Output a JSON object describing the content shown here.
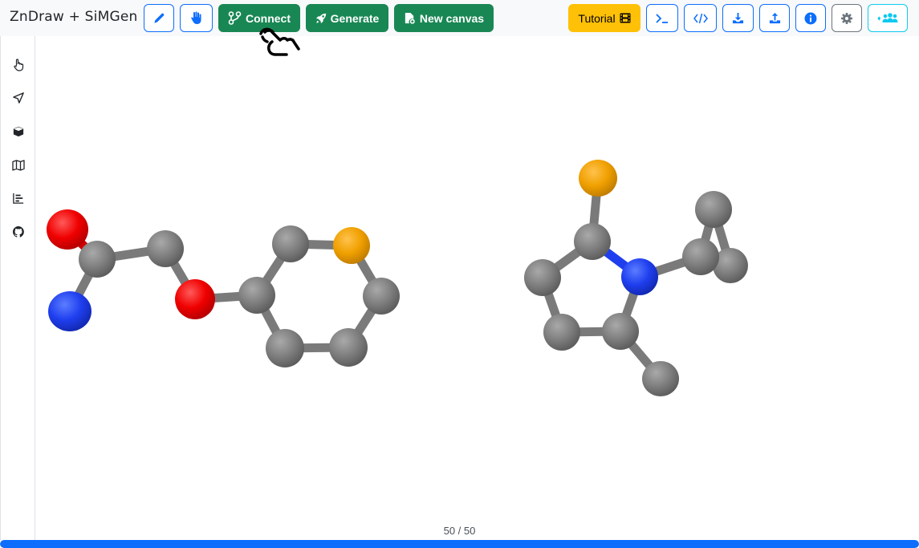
{
  "app": {
    "title": "ZnDraw + SiMGen"
  },
  "toolbar": {
    "left_buttons": [
      {
        "name": "draw-button",
        "icon": "pencil-icon"
      },
      {
        "name": "interaction-button",
        "icon": "hand-icon"
      }
    ],
    "connect_label": "Connect",
    "generate_label": "Generate",
    "new_canvas_label": "New canvas",
    "tutorial_label": "Tutorial",
    "right_icons": [
      "terminal-icon",
      "code-icon",
      "download-icon",
      "upload-icon",
      "info-icon",
      "gear-icon",
      "users-icon"
    ]
  },
  "sidebar": {
    "items": [
      {
        "name": "sidebar-item-selection",
        "icon": "pointer-hand-icon"
      },
      {
        "name": "sidebar-item-geometry",
        "icon": "send-icon"
      },
      {
        "name": "sidebar-item-modifier",
        "icon": "cube-icon"
      },
      {
        "name": "sidebar-item-scene",
        "icon": "map-icon"
      },
      {
        "name": "sidebar-item-analysis",
        "icon": "bar-chart-icon"
      },
      {
        "name": "sidebar-item-github",
        "icon": "github-icon"
      }
    ]
  },
  "viewer": {
    "frame_counter": "50 / 50",
    "current_frame": 50,
    "total_frames": 50,
    "progress_fraction": 1.0,
    "element_colors": {
      "carbon": "#7f7f7f",
      "oxygen": "#ff0000",
      "nitrogen": "#1f3fff",
      "sulfur": "#f0a000"
    }
  },
  "colors": {
    "primary": "#0d6efd",
    "success": "#198754",
    "warning": "#ffc107",
    "info": "#0dcaf0",
    "secondary": "#6c757d"
  }
}
